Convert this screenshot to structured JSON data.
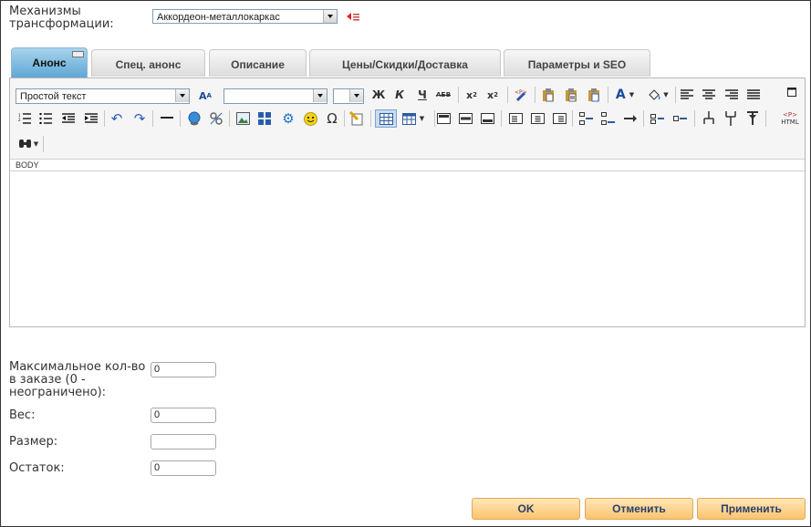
{
  "transform": {
    "label": "Механизмы трансформации:",
    "value": "Аккордеон-металлокаркас"
  },
  "tabs": [
    {
      "label": "Анонс"
    },
    {
      "label": "Спец. анонс"
    },
    {
      "label": "Описание"
    },
    {
      "label": "Цены/Скидки/Доставка"
    },
    {
      "label": "Параметры и SEO"
    }
  ],
  "editor": {
    "format_value": "Простой текст",
    "font_value": "",
    "size_value": "",
    "path": "BODY",
    "html_label": "HTML",
    "toolbar_text": {
      "bold": "Ж",
      "italic": "К",
      "underline": "Ч",
      "strike": "АБВ"
    }
  },
  "fields": [
    {
      "label": "Максимальное кол-во в заказе (0 - неограничено):",
      "value": "0"
    },
    {
      "label": "Вес:",
      "value": "0"
    },
    {
      "label": "Размер:",
      "value": ""
    },
    {
      "label": "Остаток:",
      "value": "0"
    }
  ],
  "actions": {
    "ok": "OK",
    "cancel": "Отменить",
    "apply": "Применить"
  },
  "colors": {
    "tab_active": "#5fa7d5",
    "button_bg": "#fbc46e",
    "button_text": "#2a3f6a"
  }
}
